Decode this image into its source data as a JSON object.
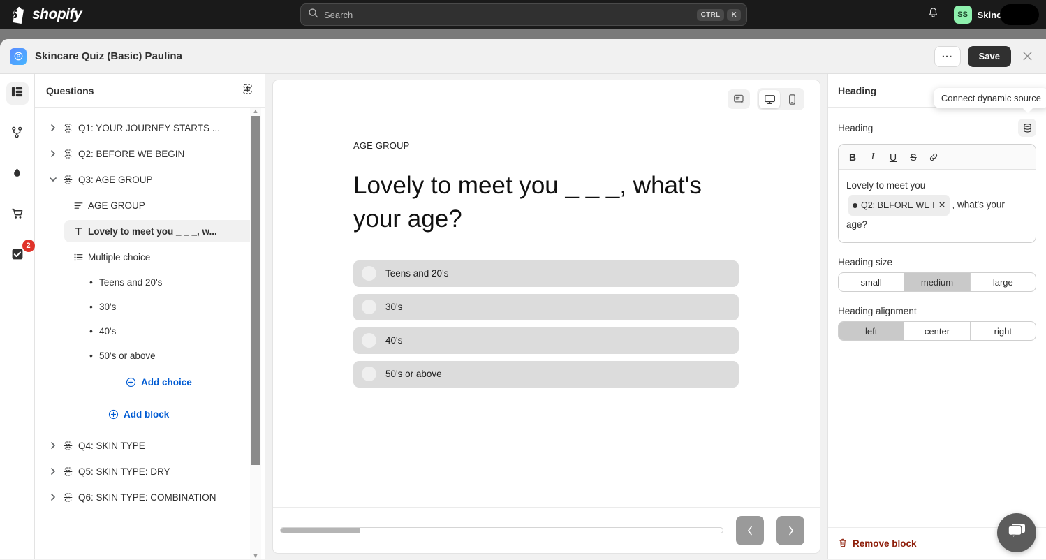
{
  "topbar": {
    "brand": "shopify",
    "brand_icon": "shopify-bag-icon",
    "search": {
      "placeholder": "Search",
      "icon": "search-icon",
      "shortcut_ctrl": "CTRL",
      "shortcut_key": "K"
    },
    "notifications_icon": "bell-icon",
    "user": {
      "initials": "SS",
      "name": "SkincareQuiz"
    }
  },
  "app_header": {
    "icon": "app-logo-icon",
    "title": "Skincare Quiz (Basic) Paulina",
    "more_label": "...",
    "save_label": "Save",
    "close_icon": "close-icon"
  },
  "rail": {
    "items": [
      {
        "name": "sections-icon",
        "icon": "list-blocks-icon",
        "active": true,
        "badge": ""
      },
      {
        "name": "flow-icon",
        "icon": "branch-icon",
        "active": false,
        "badge": ""
      },
      {
        "name": "theme-icon",
        "icon": "droplet-icon",
        "active": false,
        "badge": ""
      },
      {
        "name": "products-icon",
        "icon": "cart-icon",
        "active": false,
        "badge": ""
      },
      {
        "name": "tasks-icon",
        "icon": "checkbox-icon",
        "active": false,
        "badge": "2"
      }
    ]
  },
  "questions_panel": {
    "title": "Questions",
    "header_icon": "collapse-all-icon",
    "items": [
      {
        "type": "question",
        "label": "Q1: YOUR JOURNEY STARTS ...",
        "expanded": false
      },
      {
        "type": "question",
        "label": "Q2: BEFORE WE BEGIN",
        "expanded": false
      },
      {
        "type": "question",
        "label": "Q3: AGE GROUP",
        "expanded": true
      }
    ],
    "q3_blocks": [
      {
        "label": "AGE GROUP",
        "icon": "text-lines-icon",
        "selected": false
      },
      {
        "label": "Lovely to meet you _ _ _, w...",
        "icon": "text-type-icon",
        "selected": true
      },
      {
        "label": "Multiple choice",
        "icon": "bullet-list-icon",
        "selected": false
      }
    ],
    "q3_choices": [
      "Teens and 20's",
      "30's",
      "40's",
      "50's or above"
    ],
    "add_choice_label": "Add choice",
    "add_block_label": "Add block",
    "items_after": [
      {
        "type": "question",
        "label": "Q4: SKIN TYPE",
        "expanded": false
      },
      {
        "type": "question",
        "label": "Q5: SKIN TYPE: DRY",
        "expanded": false
      },
      {
        "type": "question",
        "label": "Q6: SKIN TYPE: COMBINATION",
        "expanded": false
      }
    ]
  },
  "preview": {
    "toolbar": [
      {
        "name": "inspect-preview-icon",
        "active": false
      },
      {
        "name": "desktop-view-icon",
        "active": true
      },
      {
        "name": "mobile-view-icon",
        "active": false
      }
    ],
    "eyebrow": "AGE GROUP",
    "heading": "Lovely to meet you _ _ _, what's your age?",
    "options": [
      "Teens and 20's",
      "30's",
      "40's",
      "50's or above"
    ],
    "progress_percent": 18,
    "prev_icon": "chevron-left-icon",
    "next_icon": "chevron-right-icon"
  },
  "inspector": {
    "title": "Heading",
    "more_label": "...",
    "tooltip": "Connect dynamic source",
    "dynamic_source_icon": "database-icon",
    "field_label": "Heading",
    "format_buttons": [
      {
        "name": "bold-icon",
        "glyph": "B"
      },
      {
        "name": "italic-icon",
        "glyph": "I"
      },
      {
        "name": "underline-icon",
        "glyph": "U"
      },
      {
        "name": "strikethrough-icon",
        "glyph": "S"
      },
      {
        "name": "link-icon",
        "glyph": "link"
      }
    ],
    "editor": {
      "text_before": "Lovely to meet you",
      "chip_label": "Q2: BEFORE WE I",
      "chip_remove_icon": "close-icon",
      "text_after": ", what's your",
      "text_line3": "age?"
    },
    "heading_size": {
      "label": "Heading size",
      "options": [
        "small",
        "medium",
        "large"
      ],
      "selected": "medium"
    },
    "heading_alignment": {
      "label": "Heading alignment",
      "options": [
        "left",
        "center",
        "right"
      ],
      "selected": "left"
    },
    "remove_label": "Remove block",
    "remove_icon": "trash-icon",
    "remove_color": "#8e1f0b"
  },
  "chat": {
    "icon": "chat-bubbles-icon"
  },
  "colors": {
    "topbar_bg": "#1a1a1a",
    "app_bg": "#f1f1f1",
    "accent_link": "#005bd3",
    "save_bg": "#303030",
    "badge_red": "#e0332a",
    "avatar_green": "#8ef0ad",
    "option_bg": "#dcdcdc"
  }
}
